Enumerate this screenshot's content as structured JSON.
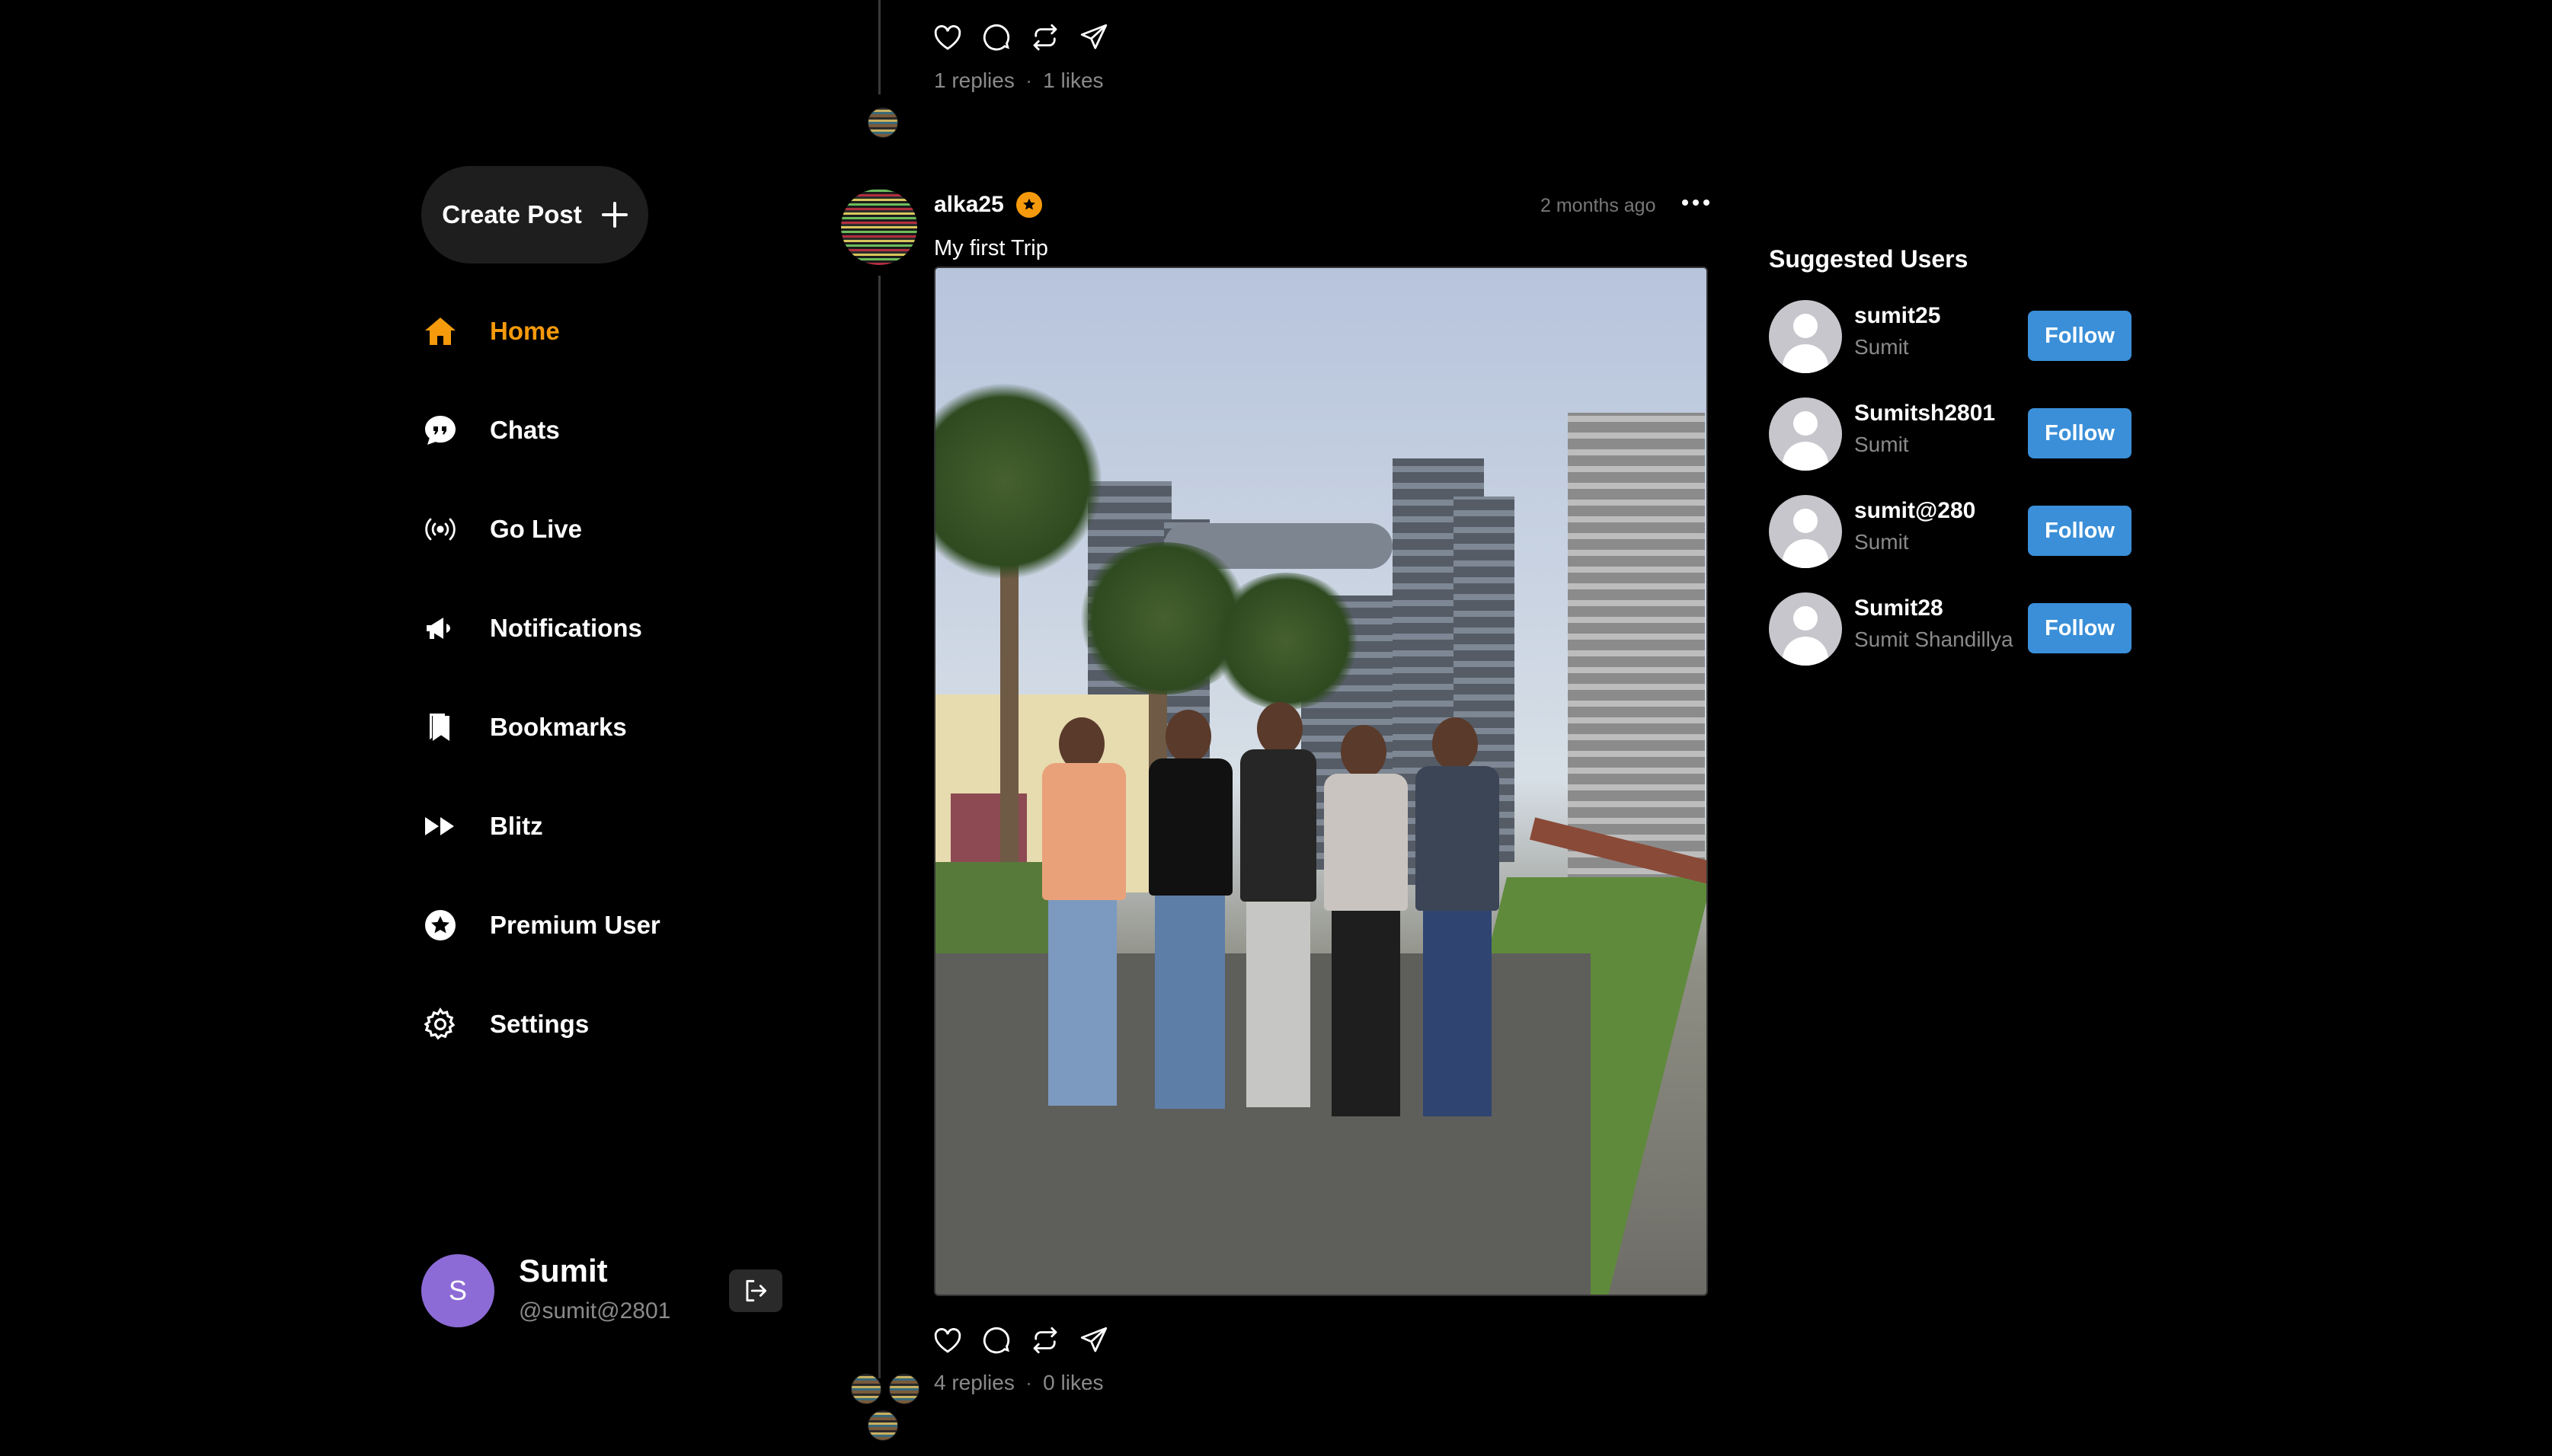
{
  "sidebar": {
    "create_post_label": "Create Post",
    "nav": [
      {
        "label": "Home",
        "icon": "home-icon",
        "active": true
      },
      {
        "label": "Chats",
        "icon": "chat-icon"
      },
      {
        "label": "Go Live",
        "icon": "broadcast-icon"
      },
      {
        "label": "Notifications",
        "icon": "megaphone-icon"
      },
      {
        "label": "Bookmarks",
        "icon": "bookmark-icon"
      },
      {
        "label": "Blitz",
        "icon": "fast-forward-icon"
      },
      {
        "label": "Premium User",
        "icon": "star-badge-icon"
      },
      {
        "label": "Settings",
        "icon": "gear-icon"
      }
    ],
    "user": {
      "initial": "S",
      "name": "Sumit",
      "handle": "@sumit@2801"
    }
  },
  "feed": {
    "prev_post": {
      "replies": "1 replies",
      "likes": "1 likes"
    },
    "post": {
      "username": "alka25",
      "time": "2 months ago",
      "text": "My first Trip",
      "replies": "4 replies",
      "likes": "0 likes"
    }
  },
  "suggested": {
    "title": "Suggested Users",
    "users": [
      {
        "username": "sumit25",
        "name": "Sumit",
        "button": "Follow"
      },
      {
        "username": "Sumitsh2801",
        "name": "Sumit",
        "button": "Follow"
      },
      {
        "username": "sumit@280",
        "name": "Sumit",
        "button": "Follow"
      },
      {
        "username": "Sumit28",
        "name": "Sumit Shandillya",
        "button": "Follow"
      }
    ]
  },
  "colors": {
    "accent": "#f59a0c",
    "follow": "#3a8fd8",
    "background": "#000000"
  }
}
